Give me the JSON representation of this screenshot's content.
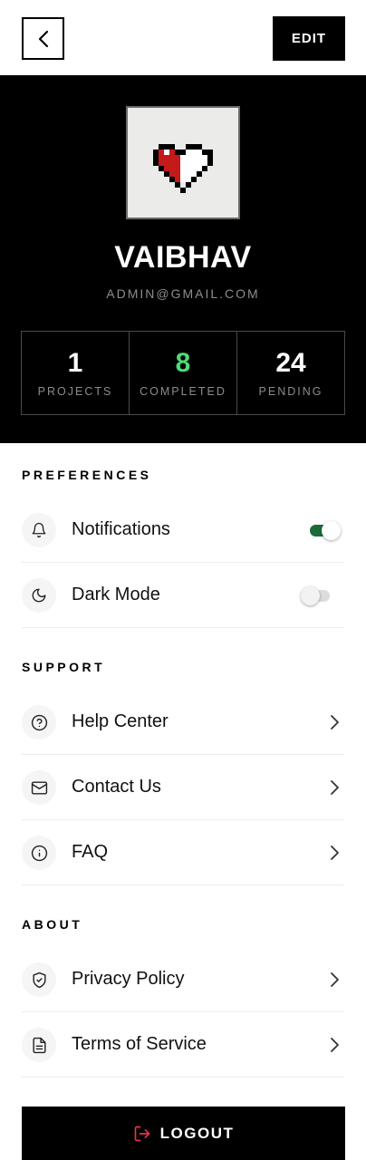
{
  "header": {
    "back_icon": "chevron-left-icon",
    "edit_label": "EDIT"
  },
  "profile": {
    "avatar_icon": "pixel-heart-icon",
    "name": "VAIBHAV",
    "email": "ADMIN@GMAIL.COM",
    "stats": [
      {
        "value": "1",
        "label": "PROJECTS"
      },
      {
        "value": "8",
        "label": "COMPLETED"
      },
      {
        "value": "24",
        "label": "PENDING"
      }
    ]
  },
  "preferences": {
    "title": "PREFERENCES",
    "items": [
      {
        "label": "Notifications",
        "icon": "bell-icon",
        "toggle": true
      },
      {
        "label": "Dark Mode",
        "icon": "moon-icon",
        "toggle": false
      }
    ]
  },
  "support": {
    "title": "SUPPORT",
    "items": [
      {
        "label": "Help Center",
        "icon": "help-circle-icon"
      },
      {
        "label": "Contact Us",
        "icon": "mail-icon"
      },
      {
        "label": "FAQ",
        "icon": "info-icon"
      }
    ]
  },
  "about": {
    "title": "ABOUT",
    "items": [
      {
        "label": "Privacy Policy",
        "icon": "shield-check-icon"
      },
      {
        "label": "Terms of Service",
        "icon": "document-icon"
      }
    ]
  },
  "logout": {
    "label": "LOGOUT",
    "icon": "logout-icon"
  },
  "colors": {
    "accent_green": "#4ddc7a",
    "toggle_on": "#1b6b3a",
    "logout_icon": "#e8334a"
  }
}
